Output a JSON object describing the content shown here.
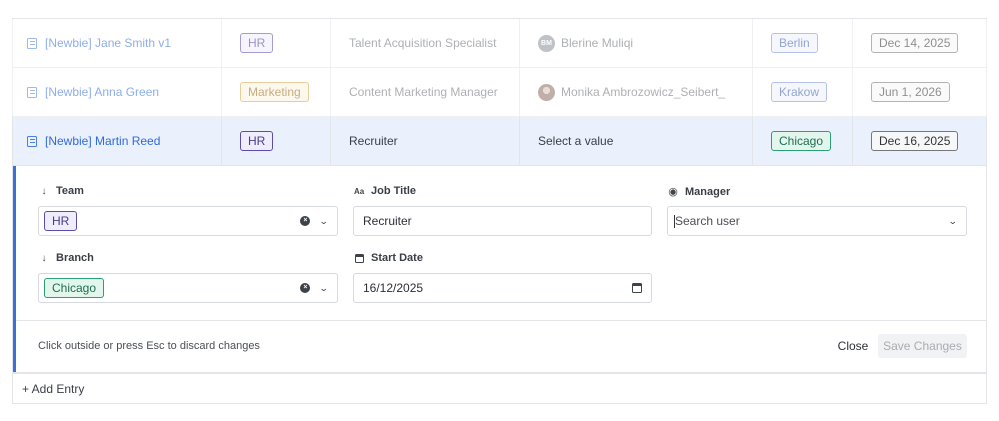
{
  "rows": [
    {
      "name": "[Newbie] Jane Smith v1",
      "team": "HR",
      "job_title": "Talent Acquisition Specialist",
      "manager_initials": "BM",
      "manager": "Blerine Muliqi",
      "branch": "Berlin",
      "start_date": "Dec 14, 2025"
    },
    {
      "name": "[Newbie] Anna Green",
      "team": "Marketing",
      "job_title": "Content Marketing Manager",
      "manager": "Monika Ambrozowicz_Seibert_",
      "branch": "Krakow",
      "start_date": "Jun 1, 2026"
    },
    {
      "name": "[Newbie] Martin Reed",
      "team": "HR",
      "job_title": "Recruiter",
      "manager": "Select a value",
      "branch": "Chicago",
      "start_date": "Dec 16, 2025"
    }
  ],
  "editor": {
    "team": {
      "label": "Team",
      "value": "HR"
    },
    "job_title": {
      "label": "Job Title",
      "value": "Recruiter"
    },
    "manager": {
      "label": "Manager",
      "placeholder": "Search user"
    },
    "branch": {
      "label": "Branch",
      "value": "Chicago"
    },
    "start_date": {
      "label": "Start Date",
      "value": "16/12/2025"
    },
    "hint": "Click outside or press Esc to discard changes",
    "close_label": "Close",
    "save_label": "Save Changes"
  },
  "add_entry_label": "+ Add Entry",
  "colors": {
    "accent": "#3b6fe0",
    "selected_row": "#eaf1fd"
  }
}
